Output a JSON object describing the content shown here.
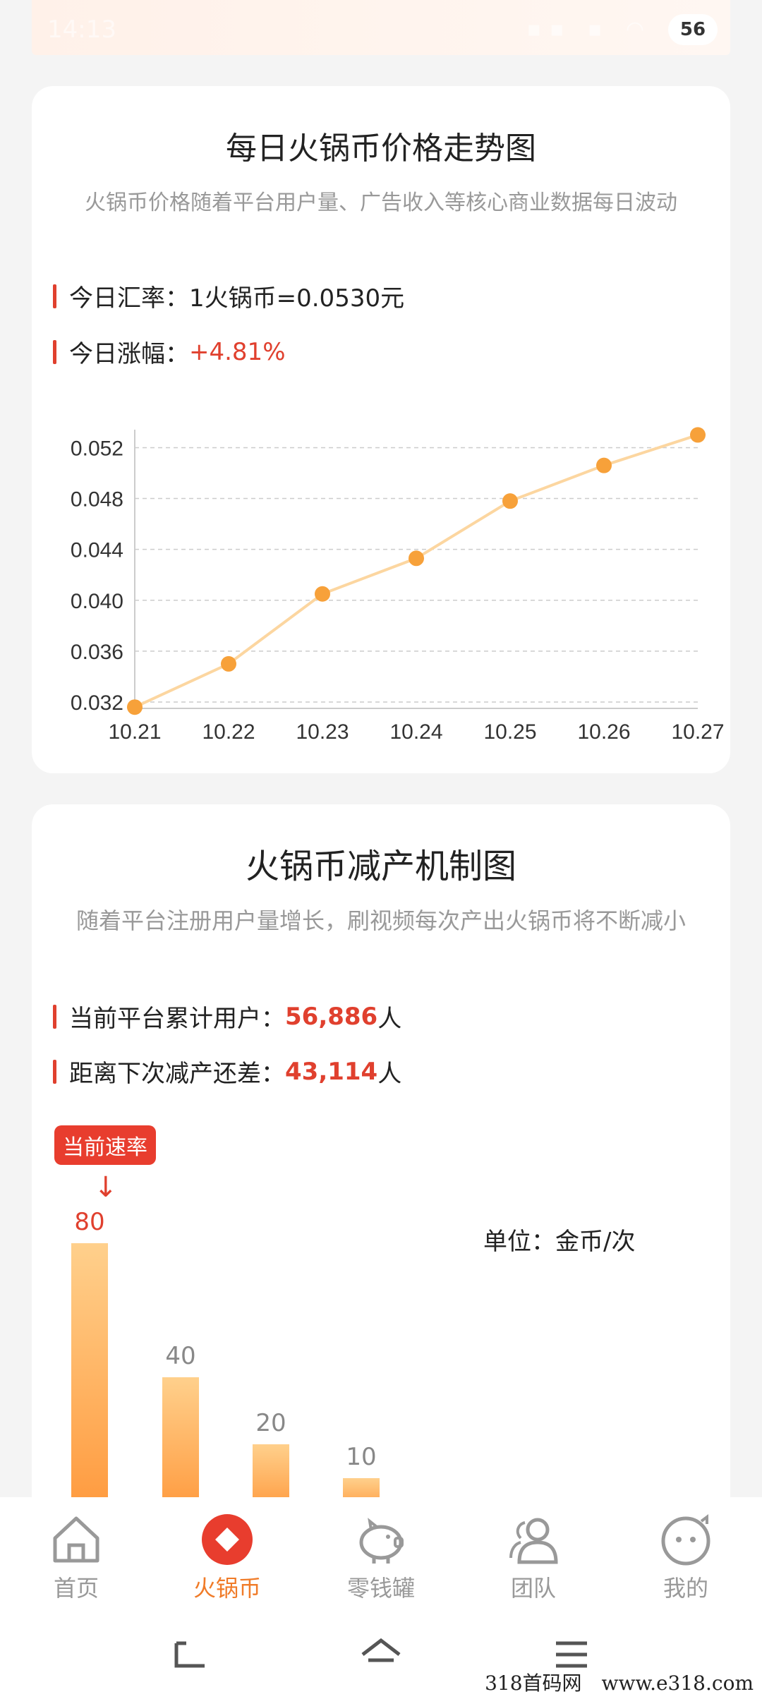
{
  "status": {
    "time": "14:13",
    "battery": "56"
  },
  "price_card": {
    "title": "每日火锅币价格走势图",
    "subtitle": "火锅币价格随着平台用户量、广告收入等核心商业数据每日波动",
    "rate_label": "今日汇率：1火锅币=0.0530元",
    "change_label": "今日涨幅：",
    "change_value": "+4.81%"
  },
  "chart_data": {
    "type": "line",
    "x": [
      "10.21",
      "10.22",
      "10.23",
      "10.24",
      "10.25",
      "10.26",
      "10.27"
    ],
    "values": [
      0.0316,
      0.035,
      0.0405,
      0.0433,
      0.0478,
      0.0506,
      0.053
    ],
    "yticks": [
      "0.032",
      "0.036",
      "0.040",
      "0.044",
      "0.048",
      "0.052"
    ],
    "ylim": [
      0.0315,
      0.0538
    ],
    "title": "",
    "xlabel": "",
    "ylabel": "",
    "grid": true,
    "line_color": "#fcd6a0",
    "marker_color": "#f7a13a"
  },
  "reduction_card": {
    "title": "火锅币减产机制图",
    "subtitle": "随着平台注册用户量增长，刷视频每次产出火锅币将不断减小",
    "users_label": "当前平台累计用户：",
    "users_value": "56,886",
    "users_unit": "人",
    "gap_label": "距离下次减产还差：",
    "gap_value": "43,114",
    "gap_unit": "人",
    "current_badge": "当前速率",
    "arrow": "↓",
    "unit_label": "单位：金币/次",
    "bars": [
      {
        "value": "80",
        "n": 80,
        "highlight": true
      },
      {
        "value": "40",
        "n": 40,
        "highlight": false
      },
      {
        "value": "20",
        "n": 20,
        "highlight": false
      },
      {
        "value": "10",
        "n": 10,
        "highlight": false
      }
    ]
  },
  "tabs": [
    {
      "label": "首页",
      "icon": "home-icon"
    },
    {
      "label": "火锅币",
      "icon": "hotpot-coin-icon",
      "active": true
    },
    {
      "label": "零钱罐",
      "icon": "piggy-bank-icon"
    },
    {
      "label": "团队",
      "icon": "team-icon"
    },
    {
      "label": "我的",
      "icon": "profile-icon"
    }
  ],
  "watermark": "318首码网　www.e318.com"
}
